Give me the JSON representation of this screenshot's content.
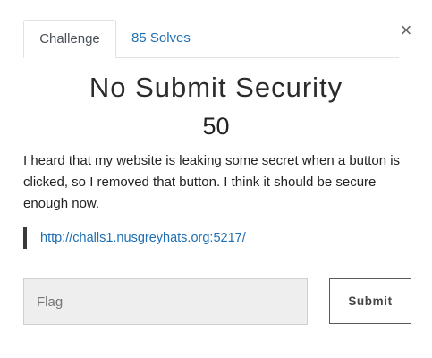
{
  "tabs": [
    {
      "label": "Challenge",
      "active": true
    },
    {
      "label": "85 Solves",
      "active": false
    }
  ],
  "close_symbol": "×",
  "challenge": {
    "name": "No Submit Security",
    "points": "50",
    "description": "I heard that my website is leaking some secret when a button is clicked, so I removed that button. I think it should be secure enough now.",
    "link": "http://challs1.nusgreyhats.org:5217/"
  },
  "form": {
    "flag_placeholder": "Flag",
    "flag_value": "",
    "submit_label": "Submit"
  },
  "colors": {
    "link": "#1f6fb2",
    "text": "#222222",
    "input_bg": "#eeeeee",
    "quote_bar": "#3a3a3a"
  }
}
